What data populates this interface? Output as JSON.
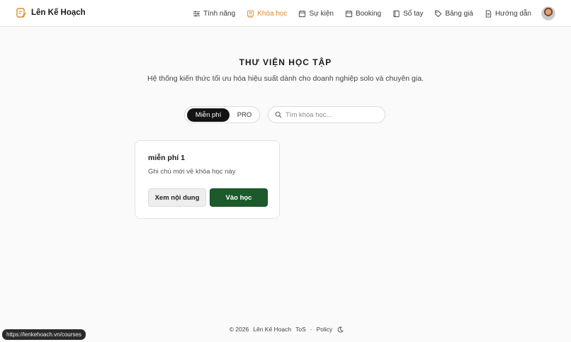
{
  "brand": {
    "name": "Lên Kế Hoạch",
    "color": "#e08a2b"
  },
  "nav": {
    "items": [
      {
        "label": "Tính năng",
        "icon": "sliders-icon",
        "active": false
      },
      {
        "label": "Khóa học",
        "icon": "book-icon",
        "active": true
      },
      {
        "label": "Sự kiện",
        "icon": "calendar-icon",
        "active": false
      },
      {
        "label": "Booking",
        "icon": "calendar-icon",
        "active": false
      },
      {
        "label": "Sổ tay",
        "icon": "notebook-icon",
        "active": false
      },
      {
        "label": "Bảng giá",
        "icon": "tag-icon",
        "active": false
      },
      {
        "label": "Hướng dẫn",
        "icon": "document-icon",
        "active": false
      }
    ]
  },
  "page": {
    "title": "THƯ VIỆN HỌC TẬP",
    "subtitle": "Hệ thống kiến thức tối ưu hóa hiệu suất dành cho doanh nghiệp solo và chuyên gia."
  },
  "filter": {
    "free_label": "Miễn phí",
    "pro_label": "PRO",
    "selected": "Miễn phí"
  },
  "search": {
    "placeholder": "Tìm khóa học...",
    "value": ""
  },
  "courses": [
    {
      "title": "miễn phí 1",
      "description": "Ghi chú mới về khóa học này",
      "view_label": "Xem nội dung",
      "enter_label": "Vào học"
    }
  ],
  "footer": {
    "copyright": "© 2026",
    "brand": "Lên Kế Hoạch",
    "tos": "ToS",
    "separator": "·",
    "policy": "Policy"
  },
  "status_bar": {
    "url": "https://lenkehoach.vn/courses"
  },
  "colors": {
    "accent": "#e08a2b",
    "primary_button": "#1c5a2c",
    "toggle_active": "#141414"
  }
}
